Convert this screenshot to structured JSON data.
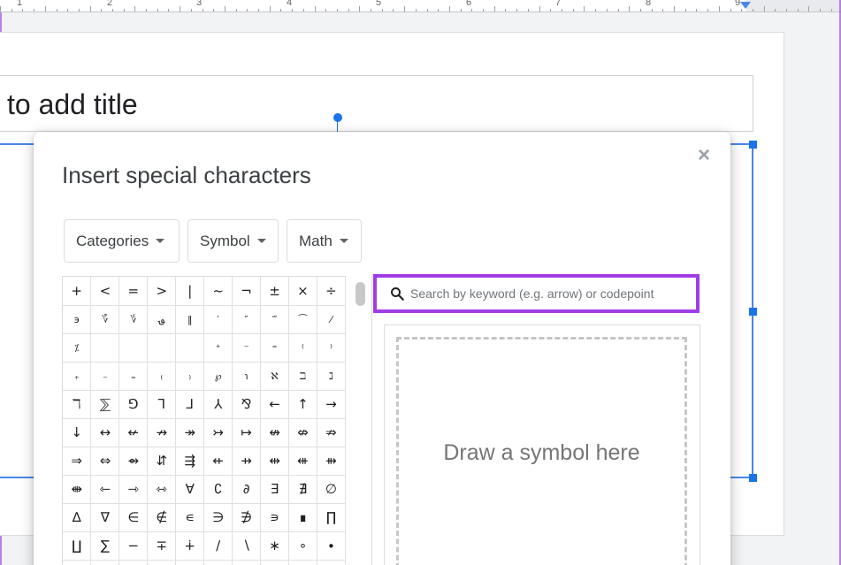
{
  "ruler": {
    "numbers": [
      "1",
      "2",
      "3",
      "4",
      "5",
      "6",
      "7",
      "8",
      "9"
    ]
  },
  "slide": {
    "title_placeholder": "to add title"
  },
  "dialog": {
    "title": "Insert special characters",
    "close_glyph": "×",
    "dropdowns": {
      "categories": "Categories",
      "symbol": "Symbol",
      "math": "Math"
    },
    "search": {
      "placeholder": "Search by keyword (e.g. arrow) or codepoint",
      "value": ""
    },
    "draw_label": "Draw a symbol here",
    "grid": [
      [
        "+",
        "<",
        "=",
        ">",
        "|",
        "~",
        "¬",
        "±",
        "×",
        "÷"
      ],
      [
        "϶",
        "؆",
        "؇",
        "؈",
        "‖",
        "′",
        "″",
        "‴",
        "⁀",
        "⁄"
      ],
      [
        "⁒",
        "",
        "",
        "",
        "",
        "⁺",
        "⁻",
        "⁼",
        "⁽",
        "⁾"
      ],
      [
        "₊",
        "₋",
        "₌",
        "₍",
        "₎",
        "℘",
        "℩",
        "ℵ",
        "ℶ",
        "ℷ"
      ],
      [
        "ℸ",
        "⅀",
        "⅁",
        "⅂",
        "⅃",
        "⅄",
        "⅋",
        "←",
        "↑",
        "→"
      ],
      [
        "↓",
        "↔",
        "↚",
        "↛",
        "↠",
        "↣",
        "↦",
        "↮",
        "⇎",
        "⇏"
      ],
      [
        "⇒",
        "⇔",
        "⇴",
        "⇵",
        "⇶",
        "⇷",
        "⇸",
        "⇹",
        "⇺",
        "⇻"
      ],
      [
        "⇼",
        "⇽",
        "⇾",
        "⇿",
        "∀",
        "∁",
        "∂",
        "∃",
        "∄",
        "∅"
      ],
      [
        "∆",
        "∇",
        "∈",
        "∉",
        "∊",
        "∋",
        "∌",
        "∍",
        "∎",
        "∏"
      ],
      [
        "∐",
        "∑",
        "−",
        "∓",
        "∔",
        "∕",
        "∖",
        "∗",
        "∘",
        "∙"
      ],
      [
        "√",
        "∛",
        "∜",
        "∝",
        "∞",
        "∟",
        "∠",
        "∡",
        "∢",
        "∣"
      ]
    ]
  },
  "colors": {
    "selection": "#4a86e8",
    "search_highlight": "#a13de8",
    "handle": "#1a73e8"
  }
}
